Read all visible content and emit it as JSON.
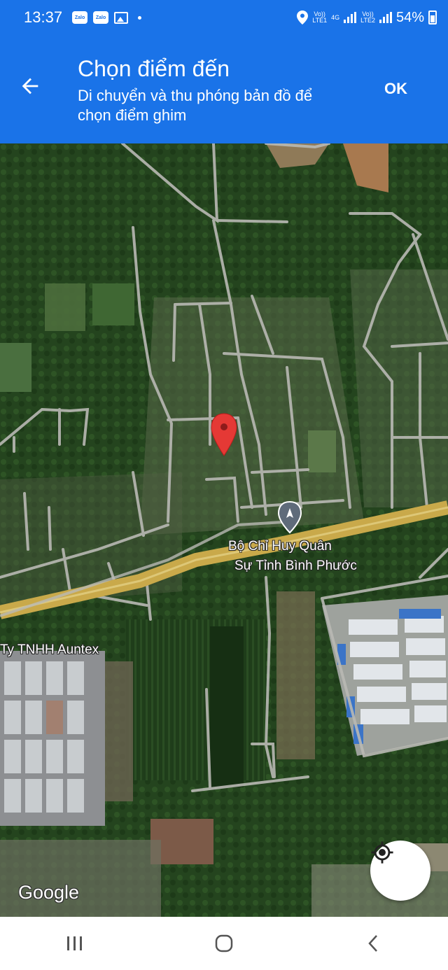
{
  "status_bar": {
    "time": "13:37",
    "badges": [
      "Zalo",
      "Zalo"
    ],
    "sim1_label": "LTE1",
    "sim2_label": "LTE2",
    "volte1": "Vo))",
    "volte2": "Vo))",
    "network": "4G",
    "battery": "54%",
    "icons": [
      "zalo-icon",
      "zalo-icon",
      "gallery-icon",
      "location-icon",
      "signal-icon",
      "battery-icon"
    ]
  },
  "app_bar": {
    "title": "Chọn điểm đến",
    "subtitle": "Di chuyển và thu phóng bản đồ để chọn điểm ghim",
    "ok_label": "OK",
    "color": "#1a73e8"
  },
  "map": {
    "labels": {
      "poi": "Bộ Chỉ Huy Quân Sự Tỉnh Bình Phước",
      "poi_line1": "Bộ Chỉ Huy Quân",
      "poi_line2": "Sự Tỉnh Bình Phước",
      "company": "Ty TNHH Auntex"
    },
    "attribution": "Google",
    "pin_color": "#e53935"
  },
  "nav_bar": {
    "icons": [
      "recents-icon",
      "home-icon",
      "back-icon"
    ]
  }
}
